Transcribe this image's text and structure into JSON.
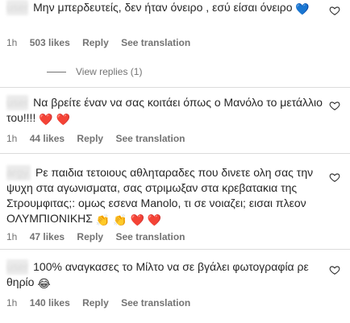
{
  "comments": [
    {
      "user": "user",
      "text": "Μην μπερδευτείς, δεν ήταν όνειρο , εσύ είσαι όνειρο",
      "emoji": "💙",
      "time": "1h",
      "likes": "503 likes",
      "reply": "Reply",
      "translate": "See translation",
      "view_replies": "View replies (1)"
    },
    {
      "user": "user",
      "text": "Να βρείτε έναν να σας κοιτάει όπως ο Μανόλο το μετάλλιο του!!!!",
      "emoji": "❤️ ❤️",
      "time": "1h",
      "likes": "44 likes",
      "reply": "Reply",
      "translate": "See translation"
    },
    {
      "user": "argy.",
      "text": "Ρε παιδια τετοιους αθληταραδες που δινετε ολη σας την ψυχη στα αγωνισματα, σας στριμωξαν στα κρεβατακια της Στρουμφιτας;: ομως εσενα Manolo, τι σε νοιαζει; εισαι πλεον ΟΛΥΜΠΙΟΝΙΚΗΣ",
      "emoji": "👏 👏 ❤️ ❤️",
      "time": "1h",
      "likes": "47 likes",
      "reply": "Reply",
      "translate": "See translation"
    },
    {
      "user": "user",
      "text": "100% αναγκασες το Μίλτο να σε βγάλει φωτογραφία ρε θηρίο",
      "emoji": "😂",
      "time": "1h",
      "likes": "140 likes",
      "reply": "Reply",
      "translate": "See translation"
    }
  ],
  "icons": {
    "like": "heart-outline-icon"
  },
  "colors": {
    "text": "#262626",
    "meta": "#737373",
    "divider": "#dbdbdb"
  }
}
